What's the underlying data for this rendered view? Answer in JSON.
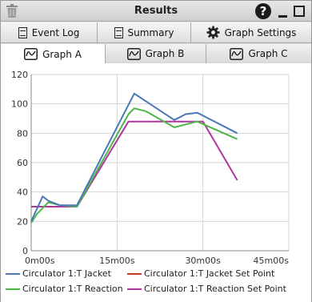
{
  "window": {
    "title": "Results"
  },
  "title_icons": {
    "trash": "trash-icon",
    "help": "?",
    "minimize": "minimize-icon",
    "maximize": "maximize-icon"
  },
  "toolbar_tabs": [
    {
      "label": "Event Log",
      "icon": "document-icon"
    },
    {
      "label": "Summary",
      "icon": "document-icon"
    },
    {
      "label": "Graph Settings",
      "icon": "gear-icon"
    }
  ],
  "graph_tabs": [
    {
      "label": "Graph A",
      "icon": "waveform-icon",
      "active": true
    },
    {
      "label": "Graph B",
      "icon": "waveform-icon",
      "active": false
    },
    {
      "label": "Graph C",
      "icon": "waveform-icon",
      "active": false
    }
  ],
  "chart_data": {
    "type": "line",
    "title": "",
    "xlabel": "",
    "ylabel": "",
    "x_ticks": [
      "0m00s",
      "15m00s",
      "30m00s",
      "45m00s"
    ],
    "y_ticks": [
      0,
      20,
      40,
      60,
      80,
      100,
      120
    ],
    "xlim_minutes": [
      0,
      45
    ],
    "ylim": [
      0,
      120
    ],
    "grid": true,
    "legend_position": "bottom",
    "series": [
      {
        "name": "Circulator 1:T Jacket",
        "color": "#4a78b8",
        "points": [
          [
            0,
            20
          ],
          [
            2,
            37
          ],
          [
            3,
            34
          ],
          [
            5,
            31
          ],
          [
            8,
            31
          ],
          [
            18,
            107
          ],
          [
            25,
            89
          ],
          [
            27,
            93
          ],
          [
            29,
            94
          ],
          [
            36,
            80
          ]
        ]
      },
      {
        "name": "Circulator 1:T Jacket Set Point",
        "color": "#c0392b",
        "points": []
      },
      {
        "name": "Circulator 1:T Reaction",
        "color": "#4db848",
        "points": [
          [
            0,
            19
          ],
          [
            1,
            25
          ],
          [
            3,
            33
          ],
          [
            5,
            31
          ],
          [
            8,
            30
          ],
          [
            17,
            93
          ],
          [
            18,
            97
          ],
          [
            20,
            95
          ],
          [
            25,
            84
          ],
          [
            27,
            86
          ],
          [
            29,
            88
          ],
          [
            36,
            76
          ]
        ]
      },
      {
        "name": "Circulator 1:T Reaction Set Point",
        "color": "#b0369e",
        "points": [
          [
            0,
            30
          ],
          [
            8,
            30
          ],
          [
            17,
            88
          ],
          [
            30,
            88
          ],
          [
            36,
            48
          ]
        ]
      }
    ]
  }
}
